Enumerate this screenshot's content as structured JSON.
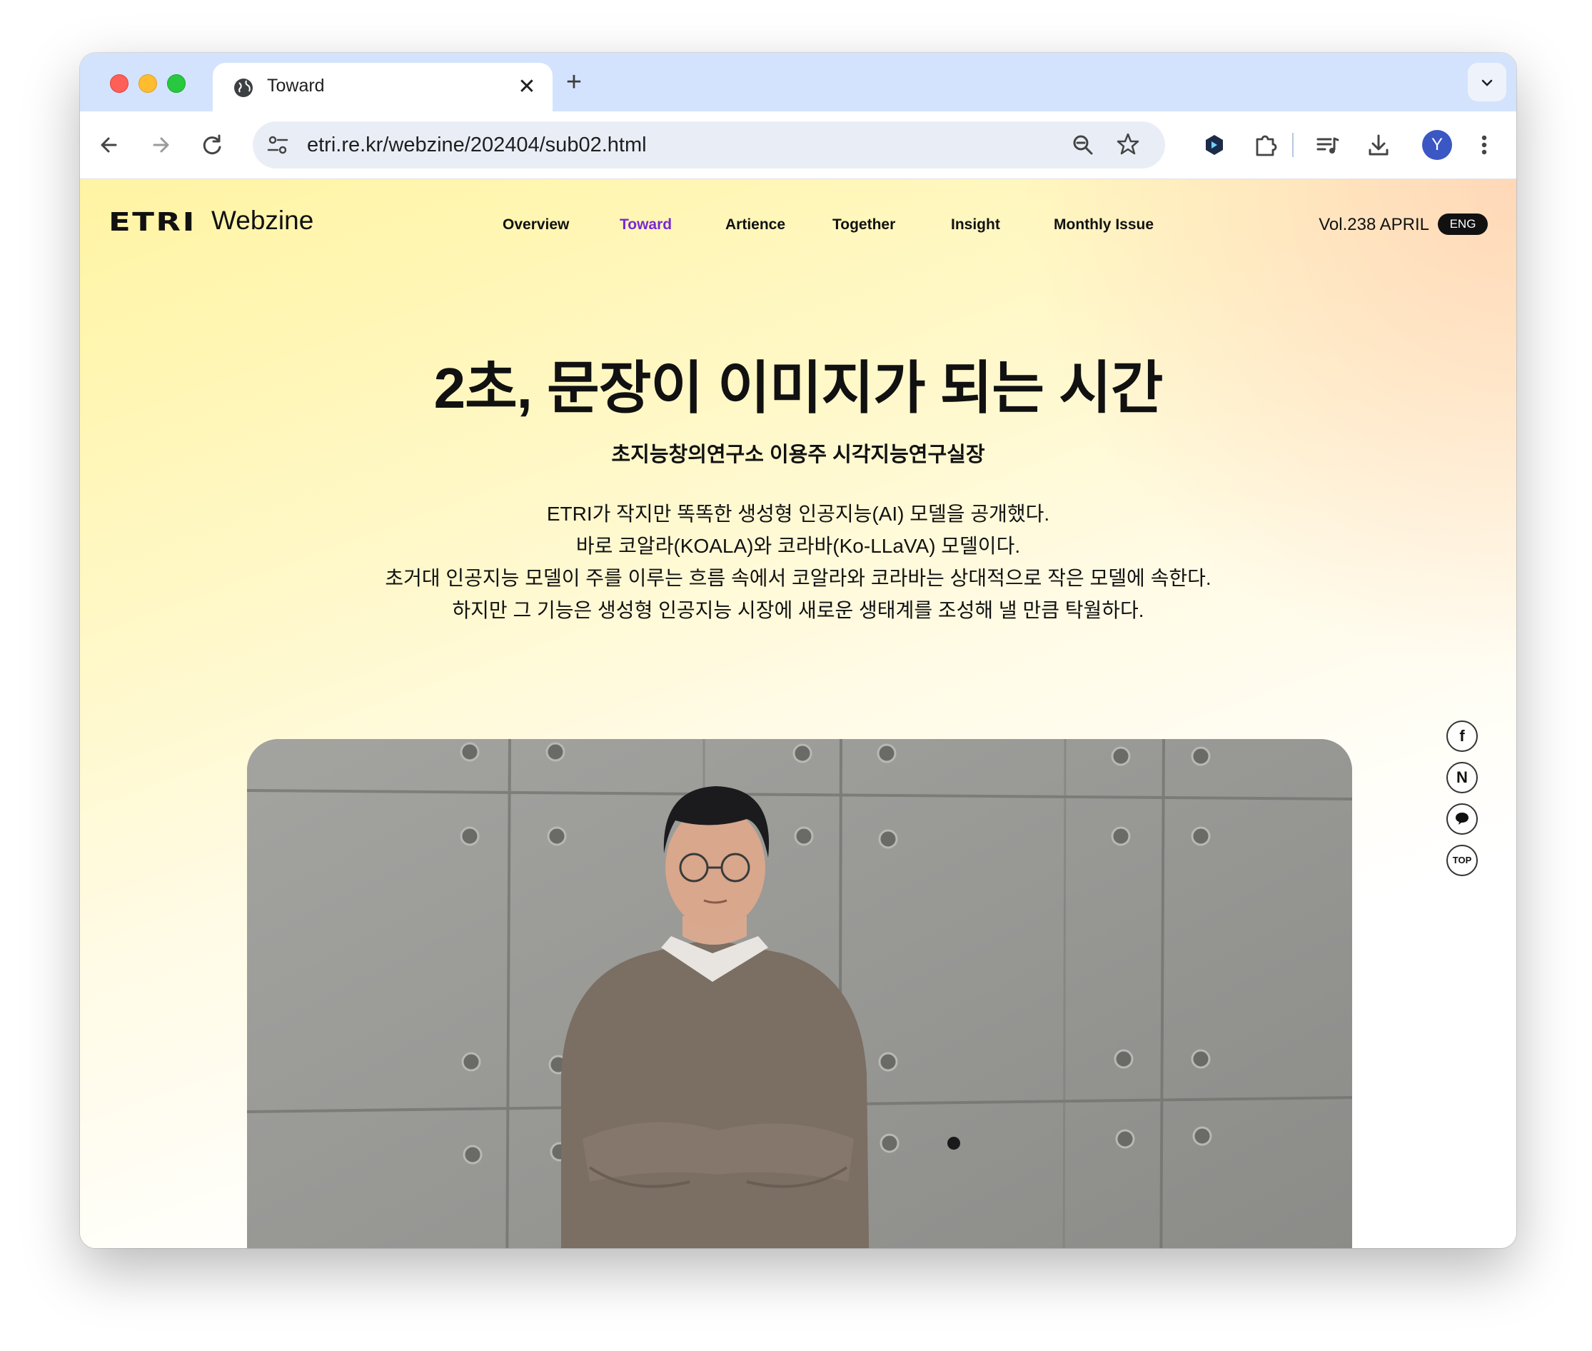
{
  "browser": {
    "tab_title": "Toward",
    "tab_close": "✕",
    "new_tab": "+",
    "url": "etri.re.kr/webzine/202404/sub02.html",
    "avatar_letter": "Y"
  },
  "site": {
    "logo_brand": "ETRI",
    "logo_product": "Webzine",
    "nav": [
      "Overview",
      "Toward",
      "Artience",
      "Together",
      "Insight",
      "Monthly Issue"
    ],
    "active_nav": "Toward",
    "volume": "Vol.238  APRIL",
    "lang_button": "ENG",
    "accent_color": "#7a27d6"
  },
  "article": {
    "title": "2초, 문장이 이미지가 되는 시간",
    "byline": "초지능창의연구소 이용주 시각지능연구실장",
    "lead": [
      "ETRI가 작지만 똑똑한 생성형 인공지능(AI) 모델을 공개했다.",
      "바로 코알라(KOALA)와 코라바(Ko-LLaVA) 모델이다.",
      "초거대 인공지능 모델이 주를 이루는 흐름 속에서 코알라와 코라바는 상대적으로 작은 모델에 속한다.",
      "하지만 그 기능은 생성형 인공지능 시장에 새로운 생태계를 조성해 낼 만큼 탁월하다."
    ]
  },
  "share": {
    "facebook": "f",
    "naver": "N",
    "kakao_icon": "chat-bubble-icon",
    "top": "TOP"
  }
}
